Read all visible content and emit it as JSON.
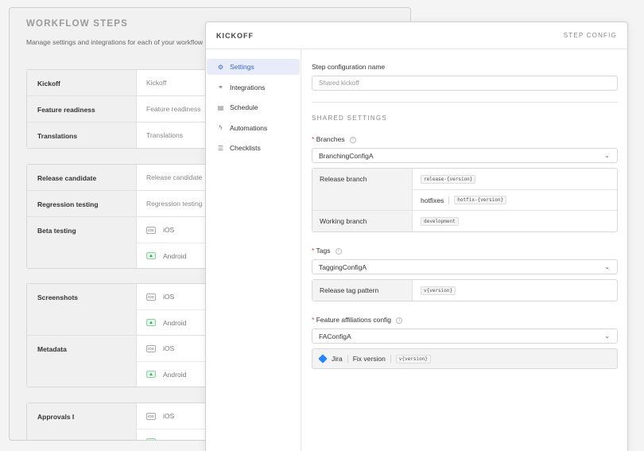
{
  "background": {
    "title": "WORKFLOW STEPS",
    "subtitle": "Manage settings and integrations for each of your workflow",
    "groups": [
      [
        {
          "name": "Kickoff",
          "cells": [
            {
              "label": "Kickoff"
            }
          ]
        },
        {
          "name": "Feature readiness",
          "cells": [
            {
              "label": "Feature readiness"
            }
          ]
        },
        {
          "name": "Translations",
          "cells": [
            {
              "label": "Translations"
            }
          ]
        }
      ],
      [
        {
          "name": "Release candidate",
          "cells": [
            {
              "label": "Release candidate"
            }
          ]
        },
        {
          "name": "Regression testing",
          "cells": [
            {
              "label": "Regression testing"
            }
          ]
        },
        {
          "name": "Beta testing",
          "cells": [
            {
              "icon": "iOS",
              "label": "iOS"
            },
            {
              "icon": "android",
              "label": "Android"
            }
          ]
        }
      ],
      [
        {
          "name": "Screenshots",
          "cells": [
            {
              "icon": "iOS",
              "label": "iOS"
            },
            {
              "icon": "android",
              "label": "Android"
            }
          ]
        },
        {
          "name": "Metadata",
          "cells": [
            {
              "icon": "iOS",
              "label": "iOS"
            },
            {
              "icon": "android",
              "label": "Android"
            }
          ]
        }
      ],
      [
        {
          "name": "Approvals I",
          "cells": [
            {
              "icon": "iOS",
              "label": "iOS"
            },
            {
              "icon": "android",
              "label": "Android"
            }
          ]
        }
      ]
    ]
  },
  "modal": {
    "title": "KICKOFF",
    "header_right": "STEP CONFIG",
    "nav": [
      {
        "label": "Settings",
        "icon": "gear-icon",
        "active": true
      },
      {
        "label": "Integrations",
        "icon": "link-icon",
        "active": false
      },
      {
        "label": "Schedule",
        "icon": "calendar-icon",
        "active": false
      },
      {
        "label": "Automations",
        "icon": "lightning-icon",
        "active": false
      },
      {
        "label": "Checklists",
        "icon": "checklist-icon",
        "active": false
      }
    ],
    "config_name_label": "Step configuration name",
    "config_name_placeholder": "Shared kickoff",
    "shared_settings_heading": "SHARED SETTINGS",
    "branches": {
      "label": "Branches",
      "selected": "BranchingConfigA",
      "release_branch_label": "Release branch",
      "release_branch_value": "release-{version}",
      "hotfixes_label": "hotfixes",
      "hotfixes_value": "hotfix-{version}",
      "working_branch_label": "Working branch",
      "working_branch_value": "development"
    },
    "tags": {
      "label": "Tags",
      "selected": "TaggingConfigA",
      "pattern_label": "Release tag pattern",
      "pattern_value": "v{version}"
    },
    "feature_affiliations": {
      "label": "Feature affiliations config",
      "selected": "FAConfigA",
      "tool": "Jira",
      "field": "Fix version",
      "value": "v{version}"
    }
  }
}
